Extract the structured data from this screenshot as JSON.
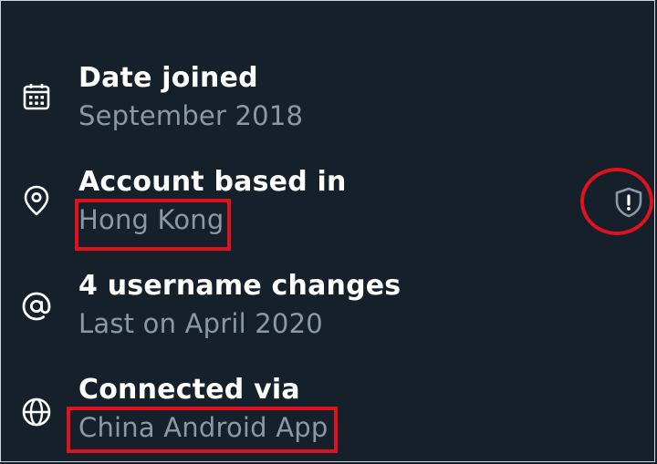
{
  "profile_about": {
    "items": [
      {
        "icon": "calendar-icon",
        "title": "Date joined",
        "value": "September 2018"
      },
      {
        "icon": "location-pin-icon",
        "title": "Account based in",
        "value": "Hong Kong"
      },
      {
        "icon": "at-sign-icon",
        "title": "4 username changes",
        "value": "Last on April 2020"
      },
      {
        "icon": "globe-icon",
        "title": "Connected via",
        "value": "China Android App"
      }
    ],
    "badge_icon": "shield-alert-icon"
  },
  "colors": {
    "background": "#15202b",
    "title_text": "#ffffff",
    "secondary_text": "#8b98a5",
    "highlight": "#e0121e"
  }
}
